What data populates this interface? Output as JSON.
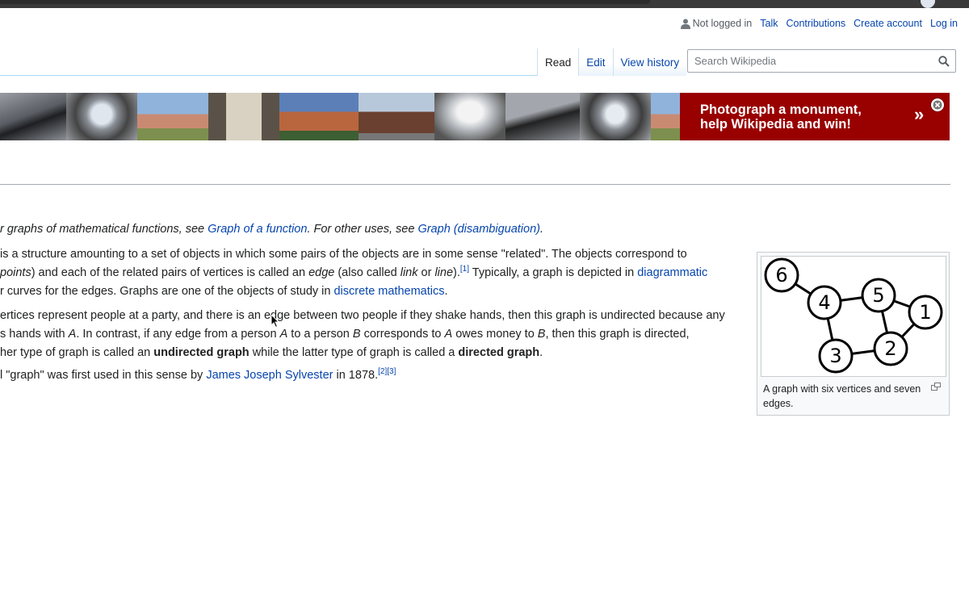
{
  "personal_nav": {
    "not_logged_in": "Not logged in",
    "talk": "Talk",
    "contributions": "Contributions",
    "create_account": "Create account",
    "log_in": "Log in"
  },
  "tabs": {
    "read": "Read",
    "edit": "Edit",
    "view_history": "View history"
  },
  "search": {
    "placeholder": "Search Wikipedia"
  },
  "banner": {
    "line1": "Photograph a monument,",
    "line2": "help Wikipedia and win!",
    "arrow": "»",
    "color": "#990000"
  },
  "hatnote": {
    "pre": "r graphs of mathematical functions, see ",
    "link1": "Graph of a function",
    "mid": ". For other uses, see ",
    "link2": "Graph (disambiguation)",
    "post": "."
  },
  "p1": {
    "l1": "is a structure amounting to a set of objects in which some pairs of the objects are in some sense \"related\". The objects correspond to",
    "l2_pre": "points",
    "l2_a": ") and each of the related pairs of vertices is called an ",
    "l2_edge": "edge",
    "l2_b": " (also called ",
    "l2_link": "link",
    "l2_or": " or ",
    "l2_line": "line",
    "l2_c": ").",
    "ref1": "[1]",
    "l2_d": " Typically, a graph is depicted in ",
    "l2_link_diag": "diagrammatic",
    "l3_a": "r curves for the edges. Graphs are one of the objects of study in ",
    "l3_link": "discrete mathematics",
    "l3_b": "."
  },
  "p2": {
    "l1": "ertices represent people at a party, and there is an edge between two people if they shake hands, then this graph is undirected because any",
    "l2_a": "s hands with ",
    "l2_A": "A",
    "l2_b": ". In contrast, if any edge from a person ",
    "l2_A2": "A",
    "l2_c": " to a person ",
    "l2_B": "B",
    "l2_d": " corresponds to ",
    "l2_A3": "A",
    "l2_e": " owes money to ",
    "l2_B2": "B",
    "l2_f": ", then this graph is directed,",
    "l3_a": "her type of graph is called an ",
    "l3_undirected": "undirected graph",
    "l3_b": " while the latter type of graph is called a ",
    "l3_directed": "directed graph",
    "l3_c": "."
  },
  "p3": {
    "a": "l \"graph\" was first used in this sense by ",
    "link": "James Joseph Sylvester",
    "b": " in 1878.",
    "ref2": "[2]",
    "ref3": "[3]"
  },
  "thumb": {
    "caption": "A graph with six vertices and seven edges.",
    "vertex_labels": [
      "6",
      "4",
      "5",
      "1",
      "3",
      "2"
    ]
  }
}
